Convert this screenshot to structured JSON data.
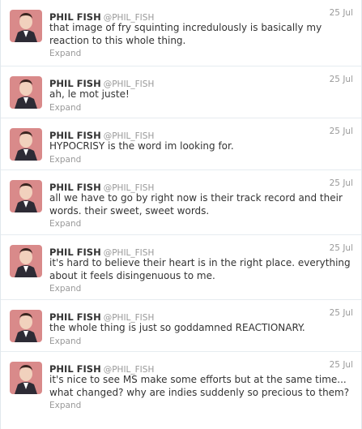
{
  "tweets": [
    {
      "name": "PHIL FISH",
      "handle": "@PHIL_FISH",
      "time": "25 Jul",
      "text": "that image of fry squinting incredulously is basically my reaction to this whole thing.",
      "expand": "Expand",
      "avatar_icon": "user-avatar-icon"
    },
    {
      "name": "PHIL FISH",
      "handle": "@PHIL_FISH",
      "time": "25 Jul",
      "text": "ah, le mot juste!",
      "expand": "Expand",
      "avatar_icon": "user-avatar-icon"
    },
    {
      "name": "PHIL FISH",
      "handle": "@PHIL_FISH",
      "time": "25 Jul",
      "text": "HYPOCRISY is the word im looking for.",
      "expand": "Expand",
      "avatar_icon": "user-avatar-icon"
    },
    {
      "name": "PHIL FISH",
      "handle": "@PHIL_FISH",
      "time": "25 Jul",
      "text": "all we have to go by right now is their track record and their words. their sweet, sweet words.",
      "expand": "Expand",
      "avatar_icon": "user-avatar-icon"
    },
    {
      "name": "PHIL FISH",
      "handle": "@PHIL_FISH",
      "time": "25 Jul",
      "text": "it's hard to believe their heart is in the right place. everything about it feels disingenuous to me.",
      "expand": "Expand",
      "avatar_icon": "user-avatar-icon"
    },
    {
      "name": "PHIL FISH",
      "handle": "@PHIL_FISH",
      "time": "25 Jul",
      "text": "the whole thing is just so goddamned REACTIONARY.",
      "expand": "Expand",
      "avatar_icon": "user-avatar-icon"
    },
    {
      "name": "PHIL FISH",
      "handle": "@PHIL_FISH",
      "time": "25 Jul",
      "text": "it's nice to see MS make some efforts but at the same time... what changed? why are indies suddenly so precious to them?",
      "expand": "Expand",
      "avatar_icon": "user-avatar-icon"
    }
  ],
  "colors": {
    "name": "#333333",
    "meta": "#999999",
    "divider": "#e6ecf0",
    "avatar_bg": "#d98a8a"
  }
}
